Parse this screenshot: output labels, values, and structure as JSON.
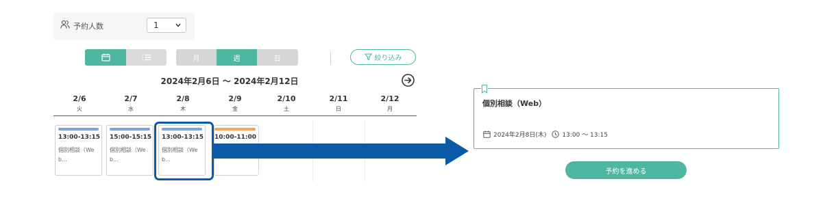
{
  "party_size": {
    "icon": "people-icon",
    "label": "予約人数",
    "selected": "1"
  },
  "view_toggle": {
    "calendar_icon": "calendar-icon",
    "list_icon": "list-icon"
  },
  "period_tabs": {
    "month": "月",
    "week": "週",
    "day": "日",
    "active": "week"
  },
  "filter": {
    "icon": "funnel-icon",
    "label": "絞り込み"
  },
  "range": {
    "title": "2024年2月6日 ～ 2024年2月12日",
    "next_icon": "arrow-right-circle-icon"
  },
  "days": [
    {
      "date": "2/6",
      "weekday": "火"
    },
    {
      "date": "2/7",
      "weekday": "水"
    },
    {
      "date": "2/8",
      "weekday": "木"
    },
    {
      "date": "2/9",
      "weekday": "金"
    },
    {
      "date": "2/10",
      "weekday": "土"
    },
    {
      "date": "2/11",
      "weekday": "日"
    },
    {
      "date": "2/12",
      "weekday": "月"
    }
  ],
  "slots": [
    {
      "time": "13:00-13:15",
      "desc": "個別相談（Web...",
      "bar_color": "#7ea3d8"
    },
    {
      "time": "15:00-15:15",
      "desc": "個別相談（Web...",
      "bar_color": "#7ea3d8"
    },
    {
      "time": "13:00-13:15",
      "desc": "個別相談（Web...",
      "bar_color": "#7ea3d8"
    },
    {
      "time": "10:00-11:00",
      "desc": "",
      "bar_color": "#f2a65a"
    }
  ],
  "detail": {
    "title": "個別相談（Web）",
    "date": "2024年2月8日(木)",
    "time": "13:00 ～ 13:15",
    "proceed_label": "予約を進める"
  },
  "colors": {
    "accent": "#4fb6a1",
    "highlight": "#0a5aa8"
  }
}
